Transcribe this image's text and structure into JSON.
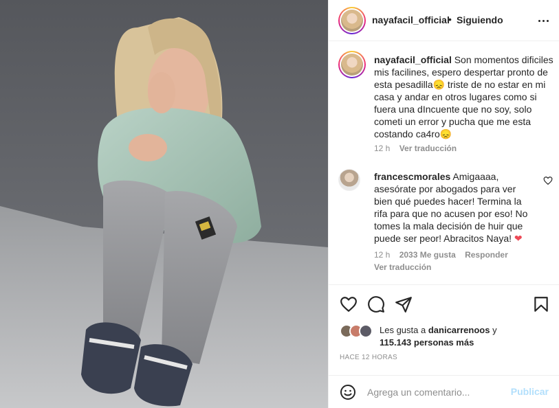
{
  "post": {
    "username": "nayafacil_official",
    "separator": "•",
    "follow_status": "Siguiendo"
  },
  "caption": {
    "username": "nayafacil_official",
    "text": "Son momentos dificiles mis facilines, espero despertar pronto de esta pesadilla😞 triste de no estar en mi casa y andar en otros lugares como si fuera una dIncuente que no soy, solo cometi un error y pucha que me esta costando ca4ro😞",
    "time": "12 h",
    "see_translation": "Ver traducción"
  },
  "comment": {
    "username": "francescmorales",
    "text": "Amigaaaa, asesórate por abogados para ver bien qué puedes hacer! Termina la rifa para que no acusen por eso! No tomes la mala decisión de huir que puede ser peor! Abracitos Naya!",
    "heart": "❤",
    "time": "12 h",
    "likes": "2033 Me gusta",
    "reply": "Responder",
    "see_translation": "Ver traducción"
  },
  "likes": {
    "prefix": "Les gusta a",
    "user": "danicarrenoos",
    "connector": "y",
    "count": "115.143 personas más"
  },
  "timestamp": "HACE 12 HORAS",
  "comment_box": {
    "placeholder": "Agrega un comentario...",
    "publish_label": "Publicar"
  },
  "icons": {
    "more": "more-horizontal-icon",
    "like": "heart-icon",
    "comment": "comment-icon",
    "share": "send-icon",
    "save": "bookmark-icon",
    "emoji": "emoji-icon"
  },
  "colors": {
    "link_disabled": "#b2dffc",
    "muted": "#8e8e8e",
    "text": "#262626",
    "heart_red": "#ed4956"
  }
}
